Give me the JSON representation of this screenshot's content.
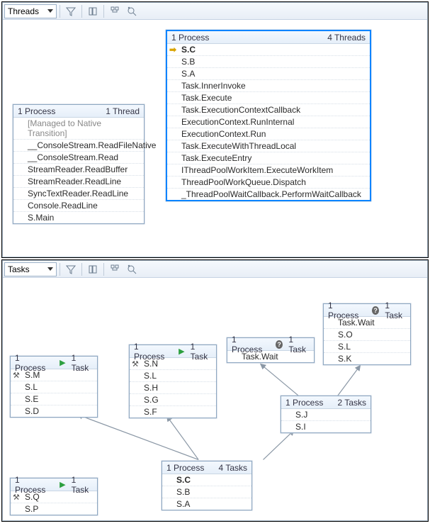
{
  "threadsPanel": {
    "viewLabel": "Threads",
    "node1": {
      "headerLeft": "1 Process",
      "headerRight": "1 Thread",
      "rows": [
        {
          "text": "[Managed to Native Transition]",
          "gray": true
        },
        {
          "text": "__ConsoleStream.ReadFileNative"
        },
        {
          "text": "__ConsoleStream.Read"
        },
        {
          "text": "StreamReader.ReadBuffer"
        },
        {
          "text": "StreamReader.ReadLine"
        },
        {
          "text": "SyncTextReader.ReadLine"
        },
        {
          "text": "Console.ReadLine"
        },
        {
          "text": "S.Main"
        }
      ]
    },
    "node2": {
      "headerLeft": "1 Process",
      "headerRight": "4 Threads",
      "rows": [
        {
          "text": "S.C",
          "bold": true,
          "current": true
        },
        {
          "text": "S.B"
        },
        {
          "text": "S.A"
        },
        {
          "text": "Task.InnerInvoke"
        },
        {
          "text": "Task.Execute"
        },
        {
          "text": "Task.ExecutionContextCallback"
        },
        {
          "text": "ExecutionContext.RunInternal"
        },
        {
          "text": "ExecutionContext.Run"
        },
        {
          "text": "Task.ExecuteWithThreadLocal"
        },
        {
          "text": "Task.ExecuteEntry"
        },
        {
          "text": "IThreadPoolWorkItem.ExecuteWorkItem"
        },
        {
          "text": "ThreadPoolWorkQueue.Dispatch"
        },
        {
          "text": "_ThreadPoolWaitCallback.PerformWaitCallback"
        }
      ]
    }
  },
  "tasksPanel": {
    "viewLabel": "Tasks",
    "nodeA": {
      "headerLeft": "1 Process",
      "icon": "play",
      "headerRight": "1 Task",
      "rows": [
        {
          "text": "S.M",
          "crossed": true
        },
        {
          "text": "S.L"
        },
        {
          "text": "S.E"
        },
        {
          "text": "S.D"
        }
      ]
    },
    "nodeB": {
      "headerLeft": "1 Process",
      "icon": "play",
      "headerRight": "1 Task",
      "rows": [
        {
          "text": "S.N",
          "crossed": true
        },
        {
          "text": "S.L"
        },
        {
          "text": "S.H"
        },
        {
          "text": "S.G"
        },
        {
          "text": "S.F"
        }
      ]
    },
    "nodeC": {
      "headerLeft": "1 Process",
      "icon": "help",
      "headerRight": "1 Task",
      "rows": [
        {
          "text": "Task.Wait"
        }
      ]
    },
    "nodeD": {
      "headerLeft": "1 Process",
      "icon": "help",
      "headerRight": "1 Task",
      "rows": [
        {
          "text": "Task.Wait"
        },
        {
          "text": "S.O"
        },
        {
          "text": "S.L"
        },
        {
          "text": "S.K"
        }
      ]
    },
    "nodeE": {
      "headerLeft": "1 Process",
      "headerRight": "2 Tasks",
      "rows": [
        {
          "text": "S.J"
        },
        {
          "text": "S.I"
        }
      ]
    },
    "nodeF": {
      "headerLeft": "1 Process",
      "headerRight": "4 Tasks",
      "rows": [
        {
          "text": "S.C",
          "bold": true
        },
        {
          "text": "S.B"
        },
        {
          "text": "S.A"
        }
      ]
    },
    "nodeG": {
      "headerLeft": "1 Process",
      "icon": "play",
      "headerRight": "1 Task",
      "rows": [
        {
          "text": "S.Q",
          "crossed": true
        },
        {
          "text": "S.P"
        }
      ]
    }
  }
}
